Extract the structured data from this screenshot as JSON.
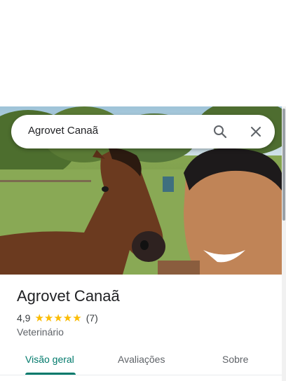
{
  "search": {
    "query": "Agrovet Canaã"
  },
  "place": {
    "name": "Agrovet Canaã",
    "rating": "4,9",
    "stars": "★★★★★",
    "review_count": "(7)",
    "category": "Veterinário"
  },
  "tabs": [
    {
      "label": "Visão geral",
      "active": true
    },
    {
      "label": "Avaliações",
      "active": false
    },
    {
      "label": "Sobre",
      "active": false
    }
  ],
  "colors": {
    "accent": "#00796b",
    "star": "#fbbc04"
  },
  "icons": {
    "search": "search-icon",
    "close": "close-icon"
  }
}
